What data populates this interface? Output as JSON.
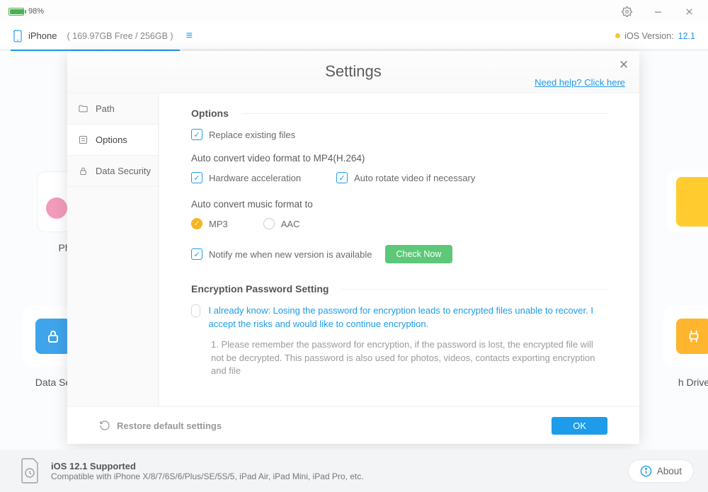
{
  "titlebar": {
    "battery_pct": "98%"
  },
  "devicebar": {
    "name": "iPhone",
    "storage": "( 169.97GB Free / 256GB )",
    "version_label": "iOS Version:",
    "version_value": "12.1"
  },
  "bg": {
    "tile0": "Pho",
    "tile1": "Data Se",
    "tile3": "h Drive"
  },
  "settings": {
    "title": "Settings",
    "help": "Need help? Click here",
    "side": {
      "path": "Path",
      "options": "Options",
      "security": "Data Security"
    },
    "options_header": "Options",
    "replace": "Replace existing files",
    "video_head": "Auto convert video format to MP4(H.264)",
    "hw_accel": "Hardware acceleration",
    "auto_rotate": "Auto rotate video if necessary",
    "music_head": "Auto convert music format to",
    "mp3": "MP3",
    "aac": "AAC",
    "notify": "Notify me when new version is available",
    "check_now": "Check Now",
    "enc_header": "Encryption Password Setting",
    "ack": "I already know: Losing the password for encryption leads to encrypted files unable to recover. I accept the risks and would like to continue encryption.",
    "note1": "1. Please remember the password for encryption, if the password is lost, the encrypted file will not be decrypted. This password is also used for photos, videos, contacts exporting encryption and file",
    "restore": "Restore default settings",
    "ok": "OK"
  },
  "bottom": {
    "supported_title": "iOS 12.1 Supported",
    "supported_sub": "Compatible with iPhone X/8/7/6S/6/Plus/SE/5S/5, iPad Air, iPad Mini, iPad Pro, etc.",
    "about": "About"
  }
}
